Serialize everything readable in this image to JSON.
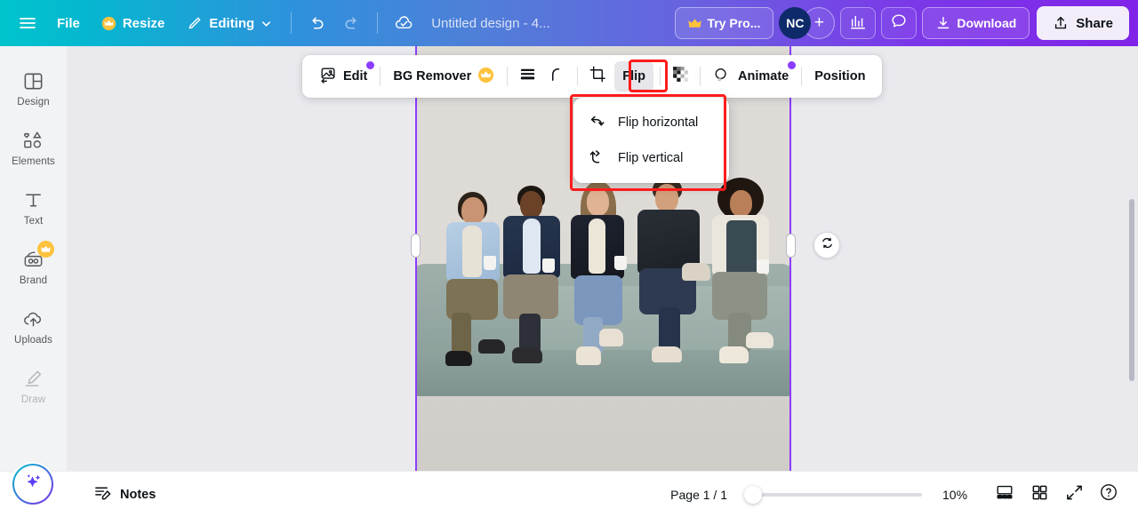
{
  "topbar": {
    "menu_icon": "hamburger-icon",
    "file_label": "File",
    "resize_label": "Resize",
    "editing_label": "Editing",
    "undo_icon": "undo-icon",
    "redo_icon": "redo-icon",
    "cloud_icon": "cloud-saved-icon",
    "doc_title": "Untitled design - 4...",
    "try_pro_label": "Try Pro...",
    "avatar_initials": "NC",
    "add_collaborator": "+",
    "insights_icon": "insights-icon",
    "comment_icon": "comment-icon",
    "download_label": "Download",
    "share_label": "Share",
    "crown_glyph": "♛",
    "gradient_start": "#00c4cc",
    "gradient_mid": "#4f7fd8",
    "gradient_end": "#8024e8"
  },
  "sidebar": {
    "items": [
      {
        "label": "Design",
        "icon": "design-icon",
        "pro": false,
        "faded": false
      },
      {
        "label": "Elements",
        "icon": "elements-icon",
        "pro": false,
        "faded": false
      },
      {
        "label": "Text",
        "icon": "text-icon",
        "pro": false,
        "faded": false
      },
      {
        "label": "Brand",
        "icon": "brand-icon",
        "pro": true,
        "faded": false
      },
      {
        "label": "Uploads",
        "icon": "uploads-icon",
        "pro": false,
        "faded": false
      },
      {
        "label": "Draw",
        "icon": "draw-icon",
        "pro": false,
        "faded": true
      }
    ]
  },
  "toolbar": {
    "edit_label": "Edit",
    "bg_remover_label": "BG Remover",
    "adjust_icon": "adjust-bars-icon",
    "corner_icon": "corner-radius-icon",
    "crop_icon": "crop-icon",
    "flip_label": "Flip",
    "transparency_icon": "transparency-icon",
    "animate_label": "Animate",
    "position_label": "Position",
    "badge_color": "#8b3dff",
    "crown_glyph": "♛"
  },
  "flip_menu": {
    "items": [
      {
        "label": "Flip horizontal",
        "icon": "flip-horizontal-icon"
      },
      {
        "label": "Flip vertical",
        "icon": "flip-vertical-icon"
      }
    ]
  },
  "annotations": {
    "color": "#ff1c1c",
    "targets": [
      "flip-button",
      "flip-dropdown-menu"
    ]
  },
  "canvas": {
    "selection_color": "#8b3dff",
    "rotate_icon": "rotate-icon",
    "image_alt": "five colleagues seated on a sofa holding mugs"
  },
  "bottombar": {
    "magic_icon": "magic-sparkle-icon",
    "notes_label": "Notes",
    "page_indicator": "Page 1 / 1",
    "zoom_value": "10%",
    "zoom_percent": 10,
    "grid_view_icon": "page-view-icon",
    "thumbnails_icon": "grid-view-icon",
    "fullscreen_icon": "fullscreen-icon",
    "help_icon": "help-icon"
  }
}
